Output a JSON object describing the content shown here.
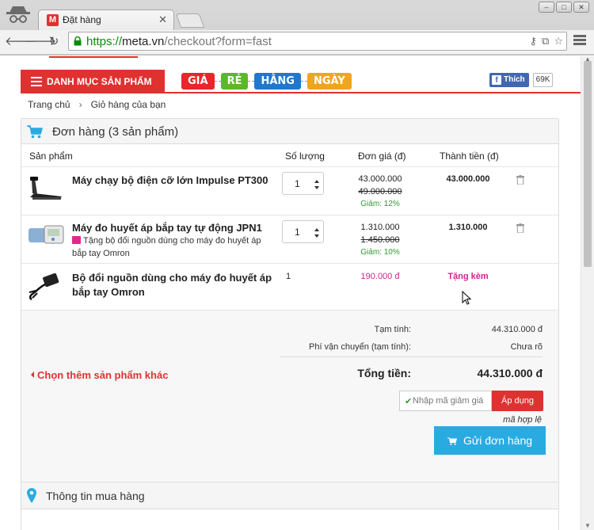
{
  "browser": {
    "tab_title": "Đặt hàng",
    "tab_favicon": "M",
    "url_scheme": "https://",
    "url_host": "meta.vn",
    "url_path": "/checkout?form=fast"
  },
  "header": {
    "category_button": "DANH MỤC SẢN PHẨM",
    "promo_words": [
      "GIÁ",
      "RẺ",
      "HẰNG",
      "NGÀY"
    ],
    "promo_colors": [
      "#e8262c",
      "#5cb82a",
      "#2277cc",
      "#f0a51e"
    ],
    "fb_like": "Thích",
    "fb_count": "69K"
  },
  "breadcrumb": {
    "home": "Trang chủ",
    "current": "Giỏ hàng của bạn"
  },
  "cart": {
    "title": "Đơn hàng (3 sản phẩm)",
    "columns": {
      "product": "Sản phẩm",
      "quantity": "Số lượng",
      "unit_price": "Đơn giá (đ)",
      "total": "Thành tiền (đ)"
    },
    "items": [
      {
        "name": "Máy chạy bộ điện cỡ lớn Impulse PT300",
        "quantity": "1",
        "price": "43.000.000",
        "old_price": "49.000.000",
        "discount": "Giảm: 12%",
        "total": "43.000.000"
      },
      {
        "name": "Máy đo huyết áp bắp tay tự động JPN1",
        "gift_note": "Tặng bộ đổi nguồn dùng cho máy đo huyết áp bắp tay Omron",
        "quantity": "1",
        "price": "1.310.000",
        "old_price": "1.450.000",
        "discount": "Giảm: 10%",
        "total": "1.310.000"
      },
      {
        "name_line1": "Bộ đổi nguồn dùng cho máy đo huyết áp",
        "name_line2": "bắp tay Omron",
        "quantity": "1",
        "price": "190.000 đ",
        "total": "Tặng kèm"
      }
    ],
    "summary": {
      "subtotal_label": "Tạm tính:",
      "subtotal_value": "44.310.000 đ",
      "shipping_label": "Phí vận chuyển (tạm tính):",
      "shipping_value": "Chưa rõ",
      "grand_label": "Tổng tiền:",
      "grand_value": "44.310.000 đ"
    },
    "more_link": "Chọn thêm sản phẩm khác",
    "coupon_placeholder": "Nhập mã giảm giá",
    "apply_label": "Áp dụng",
    "coupon_message": "mã hợp lệ",
    "submit_label": "Gửi đơn hàng"
  },
  "buyer_info": {
    "title": "Thông tin mua hàng"
  },
  "colors": {
    "brand_red": "#e03131",
    "action_blue": "#29abe2",
    "gift_pink": "#d6208f",
    "discount_green": "#2e9b2e"
  }
}
